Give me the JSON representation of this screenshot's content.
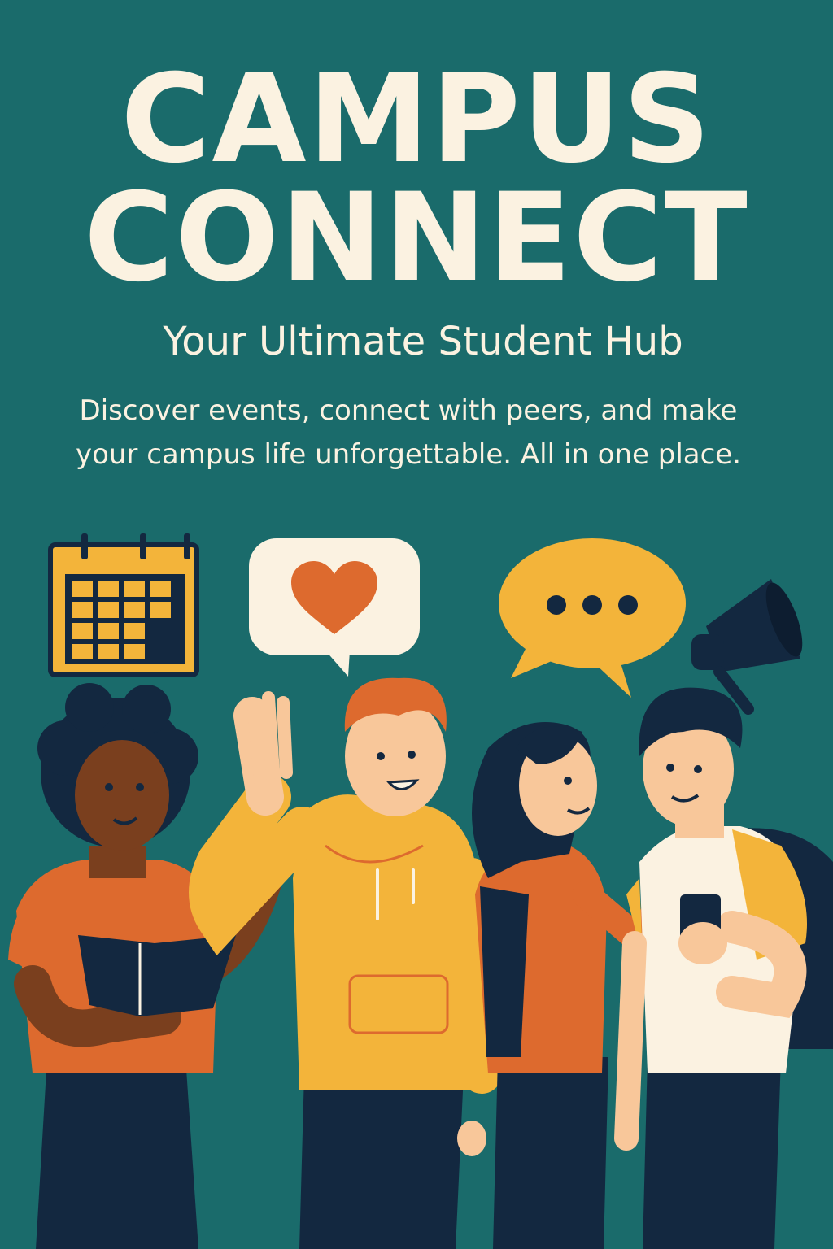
{
  "poster": {
    "title_line_1": "CAMPUS",
    "title_line_2": "CONNECT",
    "subtitle": "Your Ultimate Student Hub",
    "description": "Discover events, connect with peers, and make your campus life unforgettable. All in one place."
  },
  "icons": [
    "calendar-icon",
    "heart-speech-bubble-icon",
    "ellipsis-speech-bubble-icon",
    "megaphone-icon"
  ],
  "colors": {
    "background": "#1a6b6b",
    "text": "#fbf2e1",
    "yellow": "#f3b43a",
    "orange": "#dd6a2e",
    "navy": "#132840",
    "cream": "#fbf2e1"
  }
}
